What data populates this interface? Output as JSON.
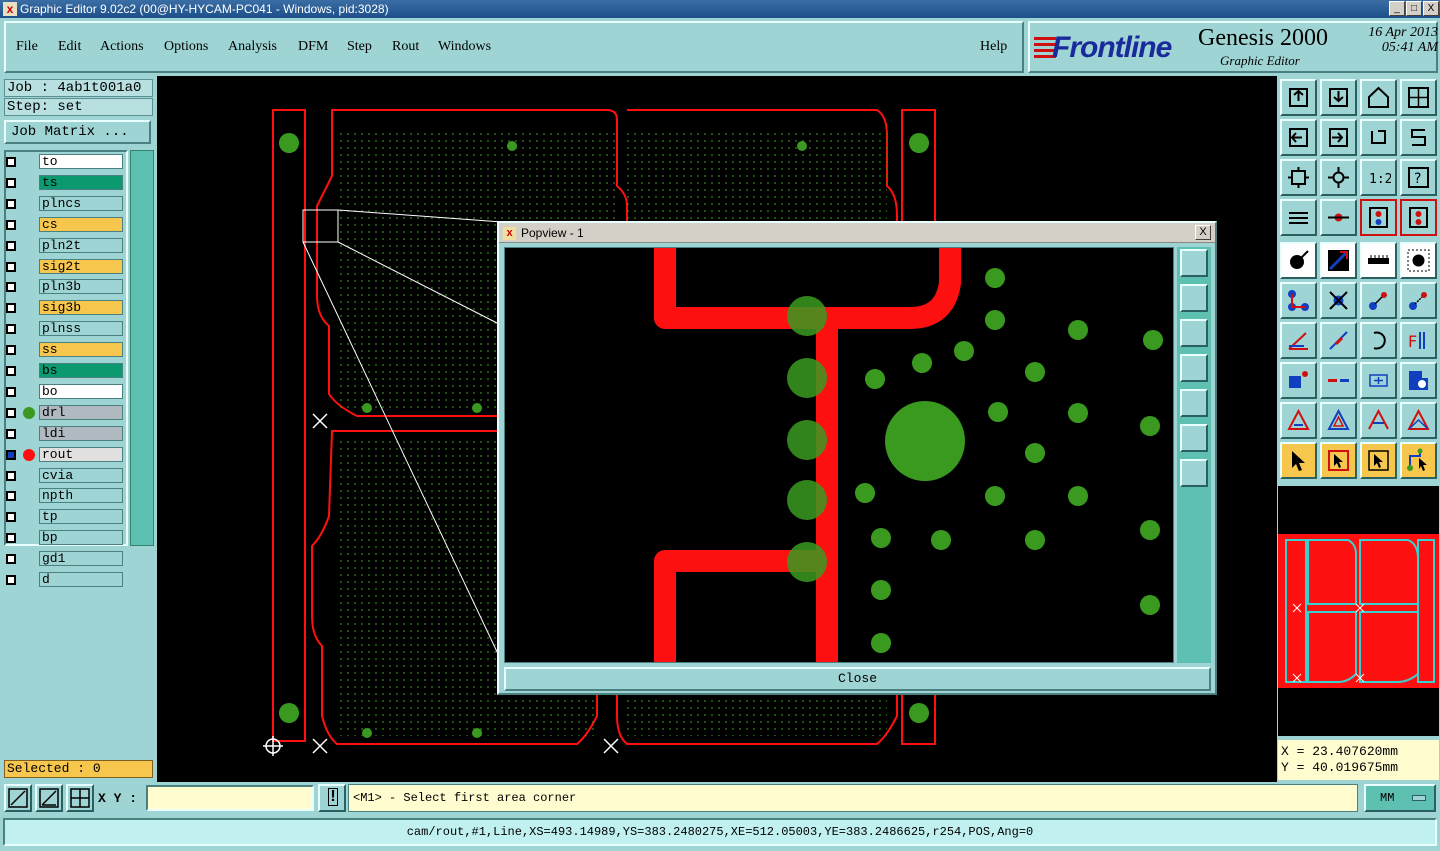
{
  "window": {
    "title": "Graphic Editor 9.02c2 (00@HY-HYCAM-PC041 - Windows, pid:3028)",
    "min_glyph": "_",
    "max_glyph": "□",
    "close_glyph": "X"
  },
  "menu": {
    "items": [
      "File",
      "Edit",
      "Actions",
      "Options",
      "Analysis",
      "DFM",
      "Step",
      "Rout",
      "Windows"
    ],
    "help": "Help"
  },
  "brand": {
    "logo": "Frontline",
    "product": "Genesis 2000",
    "subtitle": "Graphic Editor",
    "date": "16 Apr 2013",
    "time": "05:41 AM"
  },
  "job": {
    "job_text": "Job : 4ab1t001a0",
    "step_text": "Step: set",
    "matrix_button": "Job Matrix ..."
  },
  "layers": [
    {
      "name": "to",
      "bg": "#ffffff",
      "dot": ""
    },
    {
      "name": "ts",
      "bg": "#0b9a70",
      "dot": ""
    },
    {
      "name": "plncs",
      "bg": "#9fd4d4",
      "dot": ""
    },
    {
      "name": "cs",
      "bg": "#f7c64c",
      "dot": ""
    },
    {
      "name": "pln2t",
      "bg": "#9fd4d4",
      "dot": ""
    },
    {
      "name": "sig2t",
      "bg": "#f7c64c",
      "dot": ""
    },
    {
      "name": "pln3b",
      "bg": "#9fd4d4",
      "dot": ""
    },
    {
      "name": "sig3b",
      "bg": "#f7c64c",
      "dot": ""
    },
    {
      "name": "plnss",
      "bg": "#9fd4d4",
      "dot": ""
    },
    {
      "name": "ss",
      "bg": "#f7c64c",
      "dot": ""
    },
    {
      "name": "bs",
      "bg": "#0b9a70",
      "dot": ""
    },
    {
      "name": "bo",
      "bg": "#ffffff",
      "dot": ""
    },
    {
      "name": "drl",
      "bg": "#b0b8c0",
      "dot": "#3a9a20"
    },
    {
      "name": "ldi",
      "bg": "#b0b8c0",
      "dot": ""
    },
    {
      "name": "rout",
      "bg": "#e0e0e0",
      "dot": "#ff1010"
    },
    {
      "name": "cvia",
      "bg": "#9fd4d4",
      "dot": ""
    },
    {
      "name": "npth",
      "bg": "#9fd4d4",
      "dot": ""
    },
    {
      "name": "tp",
      "bg": "#9fd4d4",
      "dot": ""
    },
    {
      "name": "bp",
      "bg": "#9fd4d4",
      "dot": ""
    },
    {
      "name": "gd1",
      "bg": "#9fd4d4",
      "dot": ""
    },
    {
      "name": "d",
      "bg": "#9fd4d4",
      "dot": ""
    }
  ],
  "selected": "Selected : 0",
  "popview": {
    "title": "Popview - 1",
    "close_label": "Close",
    "close_glyph": "X"
  },
  "coords": {
    "x_text": "X = 23.407620mm",
    "y_text": "Y = 40.019675mm"
  },
  "bottom": {
    "xy_label": "X Y :",
    "xy_value": "",
    "alert_glyph": "!",
    "prompt": "<M1> - Select first area corner",
    "unit": "MM"
  },
  "status_line": "cam/rout,#1,Line,XS=493.14989,YS=383.2480275,XE=512.05003,YE=383.2486625,r254,POS,Ang=0",
  "colors": {
    "panel": "#9fd4d4",
    "rout": "#ff1010",
    "drill": "#3a9a20",
    "selected_bg": "#f7c64c"
  }
}
